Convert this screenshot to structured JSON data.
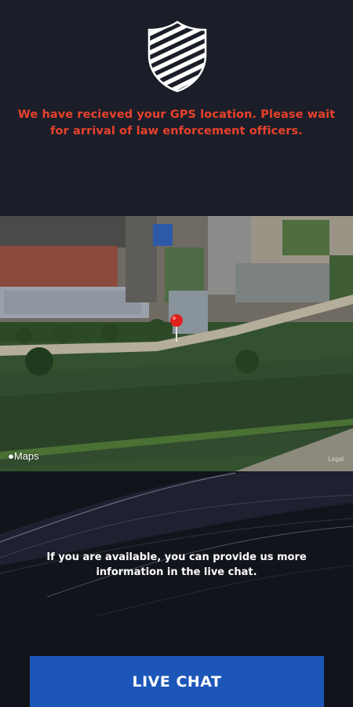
{
  "header": {
    "logo_icon": "striped-shield-icon",
    "alert_text": "We have recieved your GPS location. Please wait for arrival of law enforcement officers.",
    "alert_color": "#e8412c"
  },
  "map": {
    "attribution": "Maps",
    "attribution_icon": "apple-icon",
    "legal": "Legal",
    "pin_icon": "location-pin-icon",
    "pin_color": "#e0201c"
  },
  "footer": {
    "info_text": "If you are available, you can provide us more information in the live chat.",
    "live_chat_label": "LIVE CHAT",
    "button_color": "#1c56b8"
  }
}
